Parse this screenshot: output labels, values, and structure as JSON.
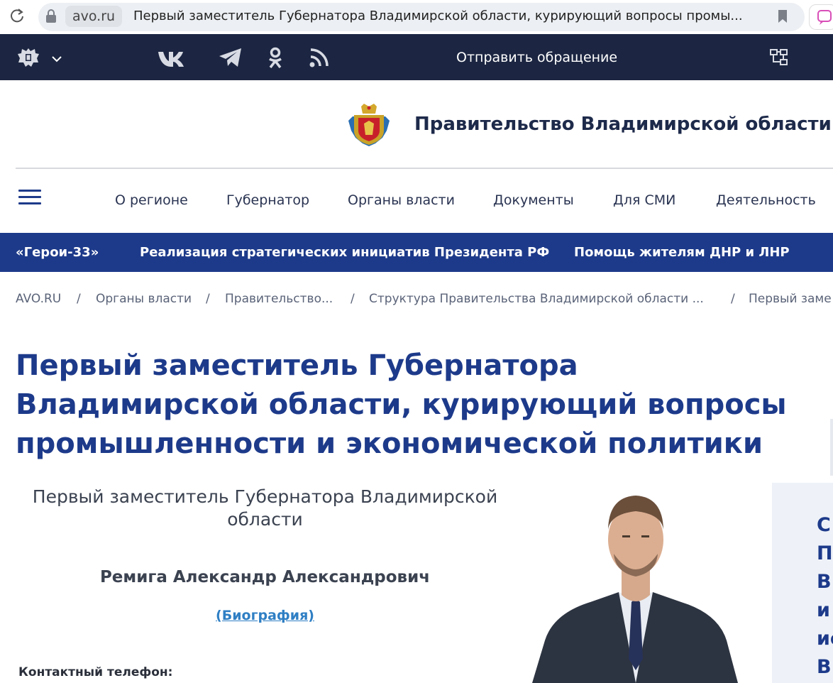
{
  "browser": {
    "domain": "avo.ru",
    "tab_title": "Первый заместитель Губернатора Владимирской области, курирующий вопросы промы..."
  },
  "topbar": {
    "appeal_label": "Отправить обращение",
    "social_icons": [
      "vk-icon",
      "telegram-icon",
      "odnoklassniki-icon",
      "rss-icon"
    ]
  },
  "header": {
    "title": "Правительство Владимирской области"
  },
  "nav": {
    "items": [
      "О регионе",
      "Губернатор",
      "Органы власти",
      "Документы",
      "Для СМИ",
      "Деятельность"
    ]
  },
  "ribbon": {
    "items": [
      "«Герои-33»",
      "Реализация стратегических инициатив Президента РФ",
      "Помощь жителям ДНР и ЛНР"
    ]
  },
  "breadcrumb": {
    "items": [
      "AVO.RU",
      "Органы власти",
      "Правительство...",
      "Структура Правительства Владимирской области ...",
      "Первый заме"
    ],
    "separator": "/"
  },
  "page": {
    "heading_lines": [
      "Первый заместитель Губернатора",
      "Владимирской области, курирующий вопросы",
      "промышленности и экономической политики"
    ],
    "position_lines": [
      "Первый заместитель Губернатора Владимирской",
      "области"
    ],
    "person_name": "Ремига Александр Александрович",
    "bio_link": "(Биография)",
    "phone_label": "Контактный телефон:"
  },
  "side_panel": {
    "lines": [
      "С",
      "П",
      "В",
      "и",
      "ис",
      "В"
    ]
  },
  "colors": {
    "topbar": "#1c2642",
    "ribbon": "#1d3a8a",
    "heading": "#1d3a8a",
    "link": "#2f7fc4"
  }
}
